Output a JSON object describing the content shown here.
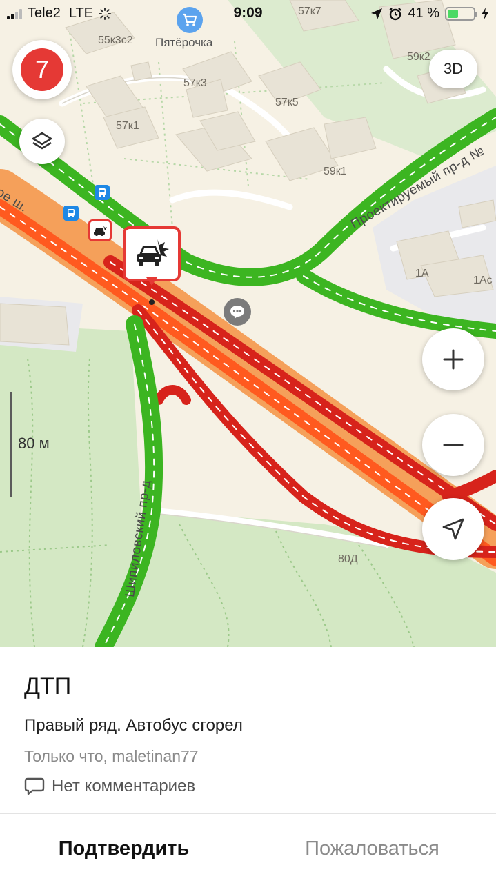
{
  "status_bar": {
    "carrier": "Tele2",
    "network": "LTE",
    "time": "9:09",
    "battery_percent_label": "41 %",
    "battery_level": 0.41
  },
  "map": {
    "traffic_score": "7",
    "btn_3d": "3D",
    "scale_label": "80 м",
    "poi_shop_name": "Пятёрочка",
    "building_labels": [
      "55к3с2",
      "57к7",
      "59к2",
      "57к3",
      "57к5",
      "57к1",
      "59к1",
      "1А",
      "1Ас",
      "80Д"
    ],
    "street_labels": [
      "Проектируемый пр-д №",
      "Шипиловский пр-д",
      "ое ш."
    ],
    "colors": {
      "traffic_green": "#3cb521",
      "traffic_red": "#e2211c",
      "traffic_orange": "#ff5a1f",
      "park": "#d4e8c4",
      "background": "#f6f1e4",
      "accent_red": "#e53935"
    },
    "icons": [
      "traffic-score-icon",
      "layers-icon",
      "zoom-in-icon",
      "zoom-out-icon",
      "locate-arrow-icon",
      "car-crash-icon",
      "chat-bubble-icon",
      "shopping-cart-icon",
      "bus-stop-icon"
    ]
  },
  "card": {
    "title": "ДТП",
    "description": "Правый ряд. Автобус сгорел",
    "meta": "Только что, maletinan77",
    "comments": "Нет комментариев",
    "confirm_label": "Подтвердить",
    "report_label": "Пожаловаться"
  }
}
